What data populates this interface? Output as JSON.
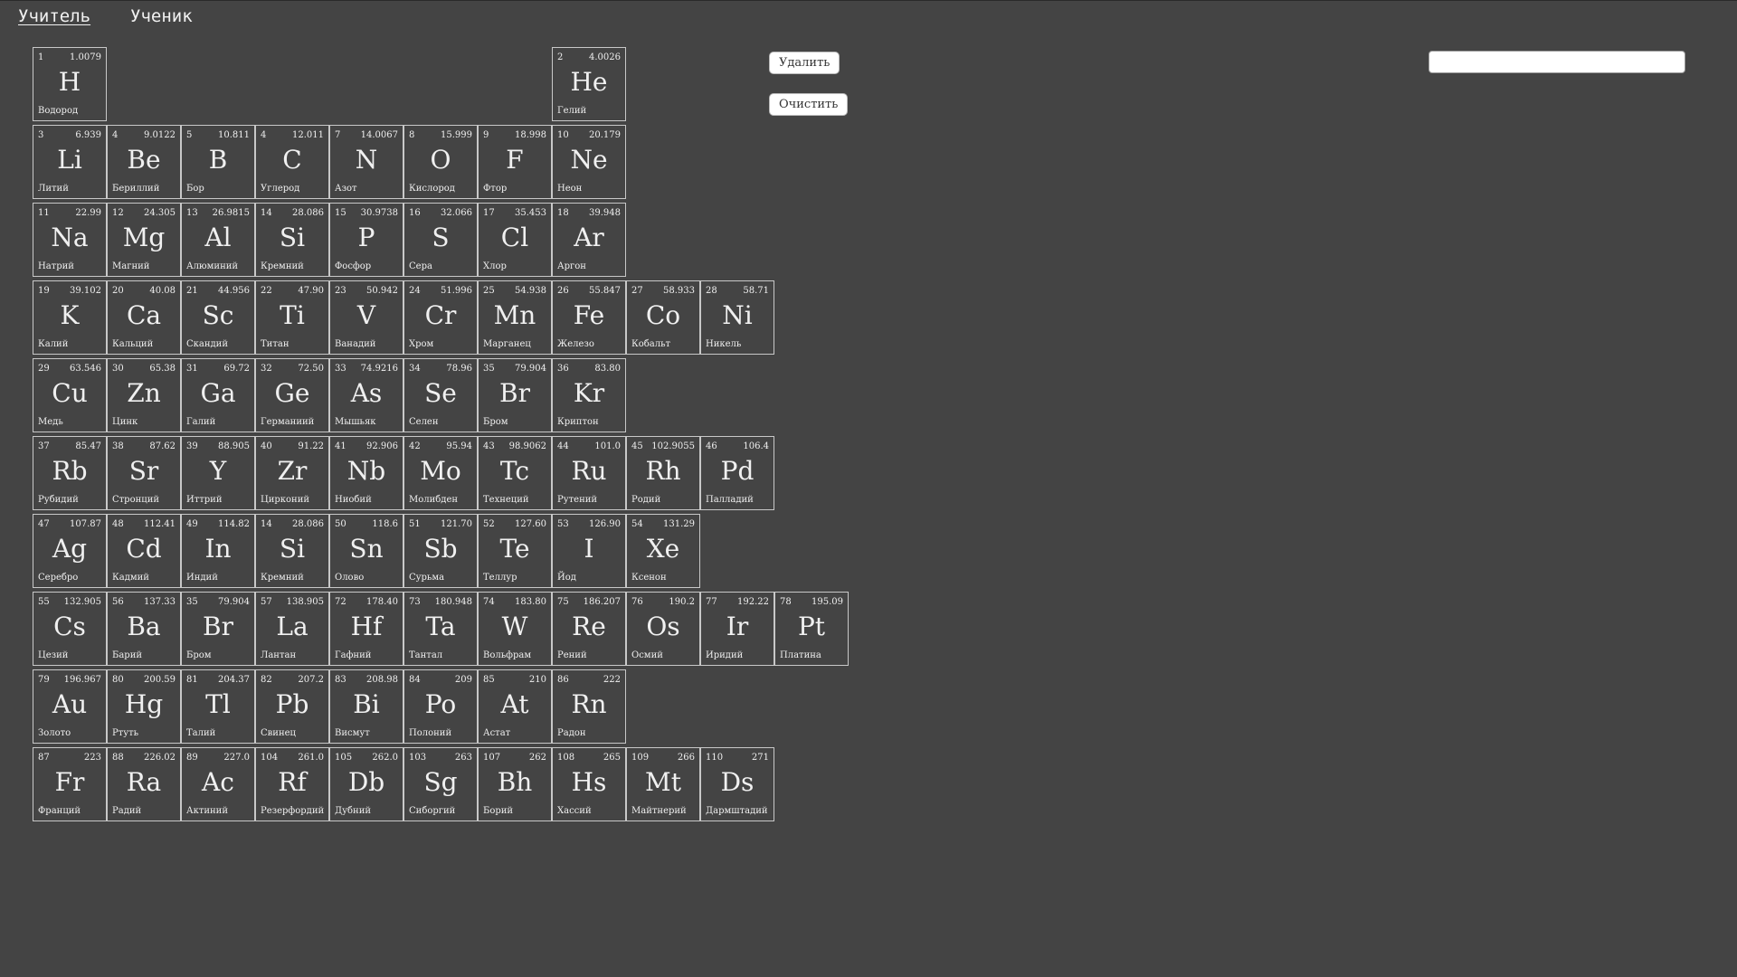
{
  "tabs": {
    "teacher": "Учитель",
    "student": "Ученик"
  },
  "buttons": {
    "delete": "Удалить",
    "clear": "Очистить"
  },
  "search": {
    "value": "",
    "placeholder": ""
  },
  "rows": [
    [
      {
        "n": "1",
        "m": "1.0079",
        "s": "H",
        "name": "Водород"
      },
      null,
      null,
      null,
      null,
      null,
      null,
      {
        "n": "2",
        "m": "4.0026",
        "s": "He",
        "name": "Гелий"
      }
    ],
    [
      {
        "n": "3",
        "m": "6.939",
        "s": "Li",
        "name": "Литий"
      },
      {
        "n": "4",
        "m": "9.0122",
        "s": "Be",
        "name": "Бериллий"
      },
      {
        "n": "5",
        "m": "10.811",
        "s": "B",
        "name": "Бор"
      },
      {
        "n": "4",
        "m": "12.011",
        "s": "C",
        "name": "Углерод"
      },
      {
        "n": "7",
        "m": "14.0067",
        "s": "N",
        "name": "Азот"
      },
      {
        "n": "8",
        "m": "15.999",
        "s": "O",
        "name": "Кислород"
      },
      {
        "n": "9",
        "m": "18.998",
        "s": "F",
        "name": "Фтор"
      },
      {
        "n": "10",
        "m": "20.179",
        "s": "Ne",
        "name": "Неон"
      }
    ],
    [
      {
        "n": "11",
        "m": "22.99",
        "s": "Na",
        "name": "Натрий"
      },
      {
        "n": "12",
        "m": "24.305",
        "s": "Mg",
        "name": "Магний"
      },
      {
        "n": "13",
        "m": "26.9815",
        "s": "Al",
        "name": "Алюминий"
      },
      {
        "n": "14",
        "m": "28.086",
        "s": "Si",
        "name": "Кремний"
      },
      {
        "n": "15",
        "m": "30.9738",
        "s": "P",
        "name": "Фосфор"
      },
      {
        "n": "16",
        "m": "32.066",
        "s": "S",
        "name": "Сера"
      },
      {
        "n": "17",
        "m": "35.453",
        "s": "Cl",
        "name": "Хлор"
      },
      {
        "n": "18",
        "m": "39.948",
        "s": "Ar",
        "name": "Аргон"
      }
    ],
    [
      {
        "n": "19",
        "m": "39.102",
        "s": "K",
        "name": "Калий"
      },
      {
        "n": "20",
        "m": "40.08",
        "s": "Ca",
        "name": "Кальций"
      },
      {
        "n": "21",
        "m": "44.956",
        "s": "Sc",
        "name": "Скандий"
      },
      {
        "n": "22",
        "m": "47.90",
        "s": "Ti",
        "name": "Титан"
      },
      {
        "n": "23",
        "m": "50.942",
        "s": "V",
        "name": "Ванадий"
      },
      {
        "n": "24",
        "m": "51.996",
        "s": "Cr",
        "name": "Хром"
      },
      {
        "n": "25",
        "m": "54.938",
        "s": "Mn",
        "name": "Марганец"
      },
      {
        "n": "26",
        "m": "55.847",
        "s": "Fe",
        "name": "Железо"
      },
      {
        "n": "27",
        "m": "58.933",
        "s": "Co",
        "name": "Кобальт"
      },
      {
        "n": "28",
        "m": "58.71",
        "s": "Ni",
        "name": "Никель"
      }
    ],
    [
      {
        "n": "29",
        "m": "63.546",
        "s": "Cu",
        "name": "Медь"
      },
      {
        "n": "30",
        "m": "65.38",
        "s": "Zn",
        "name": "Цинк"
      },
      {
        "n": "31",
        "m": "69.72",
        "s": "Ga",
        "name": "Галий"
      },
      {
        "n": "32",
        "m": "72.50",
        "s": "Ge",
        "name": "Германиий"
      },
      {
        "n": "33",
        "m": "74.9216",
        "s": "As",
        "name": "Мышьяк"
      },
      {
        "n": "34",
        "m": "78.96",
        "s": "Se",
        "name": "Селен"
      },
      {
        "n": "35",
        "m": "79.904",
        "s": "Br",
        "name": "Бром"
      },
      {
        "n": "36",
        "m": "83.80",
        "s": "Kr",
        "name": "Криптон"
      }
    ],
    [
      {
        "n": "37",
        "m": "85.47",
        "s": "Rb",
        "name": "Рубидий"
      },
      {
        "n": "38",
        "m": "87.62",
        "s": "Sr",
        "name": "Стронций"
      },
      {
        "n": "39",
        "m": "88.905",
        "s": "Y",
        "name": "Иттрий"
      },
      {
        "n": "40",
        "m": "91.22",
        "s": "Zr",
        "name": "Цирконий"
      },
      {
        "n": "41",
        "m": "92.906",
        "s": "Nb",
        "name": "Ниобий"
      },
      {
        "n": "42",
        "m": "95.94",
        "s": "Mo",
        "name": "Молибден"
      },
      {
        "n": "43",
        "m": "98.9062",
        "s": "Tc",
        "name": "Технеций"
      },
      {
        "n": "44",
        "m": "101.0",
        "s": "Ru",
        "name": "Рутений"
      },
      {
        "n": "45",
        "m": "102.9055",
        "s": "Rh",
        "name": "Родий"
      },
      {
        "n": "46",
        "m": "106.4",
        "s": "Pd",
        "name": "Палладий"
      }
    ],
    [
      {
        "n": "47",
        "m": "107.87",
        "s": "Ag",
        "name": "Серебро"
      },
      {
        "n": "48",
        "m": "112.41",
        "s": "Cd",
        "name": "Кадмий"
      },
      {
        "n": "49",
        "m": "114.82",
        "s": "In",
        "name": "Индий"
      },
      {
        "n": "14",
        "m": "28.086",
        "s": "Si",
        "name": "Кремний"
      },
      {
        "n": "50",
        "m": "118.6",
        "s": "Sn",
        "name": "Олово"
      },
      {
        "n": "51",
        "m": "121.70",
        "s": "Sb",
        "name": "Сурьма"
      },
      {
        "n": "52",
        "m": "127.60",
        "s": "Te",
        "name": "Теллур"
      },
      {
        "n": "53",
        "m": "126.90",
        "s": "I",
        "name": "Йод"
      },
      {
        "n": "54",
        "m": "131.29",
        "s": "Xe",
        "name": "Ксенон"
      }
    ],
    [
      {
        "n": "55",
        "m": "132.905",
        "s": "Cs",
        "name": "Цезий"
      },
      {
        "n": "56",
        "m": "137.33",
        "s": "Ba",
        "name": "Барий"
      },
      {
        "n": "35",
        "m": "79.904",
        "s": "Br",
        "name": "Бром"
      },
      {
        "n": "57",
        "m": "138.905",
        "s": "La",
        "name": "Лантан"
      },
      {
        "n": "72",
        "m": "178.40",
        "s": "Hf",
        "name": "Гафний"
      },
      {
        "n": "73",
        "m": "180.948",
        "s": "Ta",
        "name": "Тантал"
      },
      {
        "n": "74",
        "m": "183.80",
        "s": "W",
        "name": "Вольфрам"
      },
      {
        "n": "75",
        "m": "186.207",
        "s": "Re",
        "name": "Рений"
      },
      {
        "n": "76",
        "m": "190.2",
        "s": "Os",
        "name": "Осмий"
      },
      {
        "n": "77",
        "m": "192.22",
        "s": "Ir",
        "name": "Иридий"
      },
      {
        "n": "78",
        "m": "195.09",
        "s": "Pt",
        "name": "Платина"
      }
    ],
    [
      {
        "n": "79",
        "m": "196.967",
        "s": "Au",
        "name": "Золото"
      },
      {
        "n": "80",
        "m": "200.59",
        "s": "Hg",
        "name": "Ртуть"
      },
      {
        "n": "81",
        "m": "204.37",
        "s": "Tl",
        "name": "Талий"
      },
      {
        "n": "82",
        "m": "207.2",
        "s": "Pb",
        "name": "Свинец"
      },
      {
        "n": "83",
        "m": "208.98",
        "s": "Bi",
        "name": "Висмут"
      },
      {
        "n": "84",
        "m": "209",
        "s": "Po",
        "name": "Полоний"
      },
      {
        "n": "85",
        "m": "210",
        "s": "At",
        "name": "Астат"
      },
      {
        "n": "86",
        "m": "222",
        "s": "Rn",
        "name": "Радон"
      }
    ],
    [
      {
        "n": "87",
        "m": "223",
        "s": "Fr",
        "name": "Франций"
      },
      {
        "n": "88",
        "m": "226.02",
        "s": "Ra",
        "name": "Радий"
      },
      {
        "n": "89",
        "m": "227.0",
        "s": "Ac",
        "name": "Актиний"
      },
      {
        "n": "104",
        "m": "261.0",
        "s": "Rf",
        "name": "Резерфордий"
      },
      {
        "n": "105",
        "m": "262.0",
        "s": "Db",
        "name": "Дубний"
      },
      {
        "n": "103",
        "m": "263",
        "s": "Sg",
        "name": "Сиборгий"
      },
      {
        "n": "107",
        "m": "262",
        "s": "Bh",
        "name": "Борий"
      },
      {
        "n": "108",
        "m": "265",
        "s": "Hs",
        "name": "Хассий"
      },
      {
        "n": "109",
        "m": "266",
        "s": "Mt",
        "name": "Майтнерий"
      },
      {
        "n": "110",
        "m": "271",
        "s": "Ds",
        "name": "Дармштадий"
      }
    ]
  ]
}
